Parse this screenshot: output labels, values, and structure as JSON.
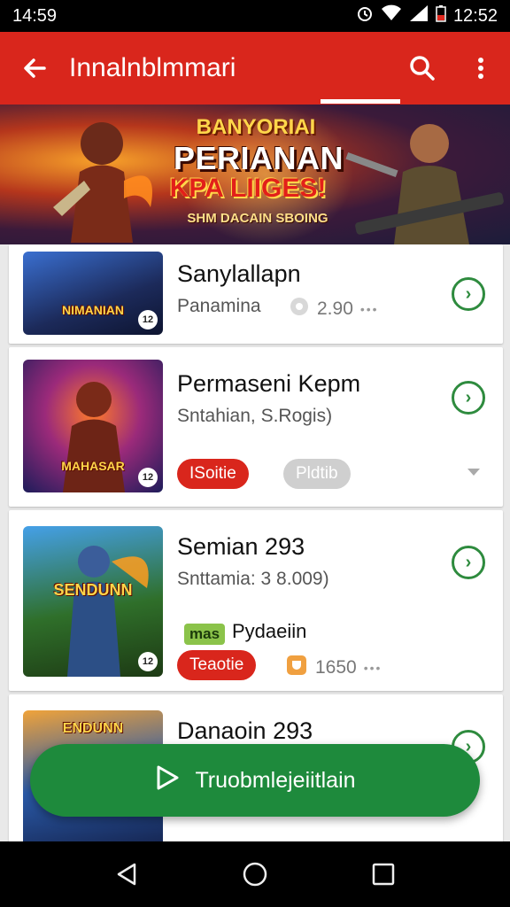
{
  "status_bar": {
    "time_left": "14:59",
    "time_right": "12:52"
  },
  "app_bar": {
    "title": "Innalnblmmari"
  },
  "banner": {
    "line1": "BANYORIAI",
    "line2": "PERIANAN",
    "line3": "KPA LIIGES!",
    "line4": "SHM DACAIN SBOING"
  },
  "items": [
    {
      "title": "Sanylallapn",
      "subtitle": "Panamina",
      "rating": "2.90",
      "thumb_caption": "NIMANIAN"
    },
    {
      "title": "Permaseni Kepm",
      "subtitle": "Sntahian, S.Rogis)",
      "badge_primary": "ISoitie",
      "badge_secondary": "Pldtib",
      "thumb_caption": "MAHASAR"
    },
    {
      "title": "Semian 293",
      "subtitle": "Snttamia: 3 8.009)",
      "tag": "mas",
      "tag_text": "Pydaeiin",
      "badge_primary": "Teaotie",
      "rating": "1650",
      "thumb_caption": "SENDUNN"
    },
    {
      "title": "Danaoin 293",
      "thumb_caption": "ENDUNN"
    }
  ],
  "fab": {
    "label": "Truobmlejeiitlain"
  },
  "colors": {
    "primary": "#d9261c",
    "accent": "#1e8a3c"
  }
}
